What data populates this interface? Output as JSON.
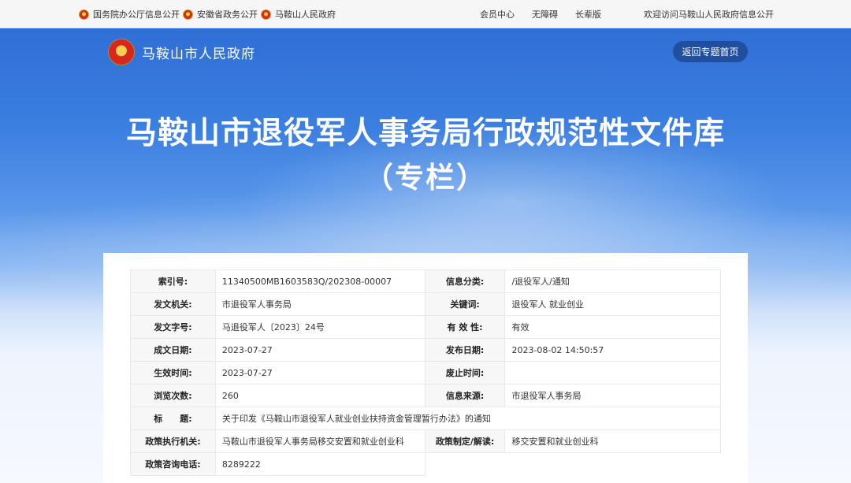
{
  "topbar": {
    "links": [
      "国务院办公厅信息公开",
      "安徽省政务公开",
      "马鞍山人民政府"
    ],
    "right_links": [
      "会员中心",
      "无障碍",
      "长辈版"
    ],
    "welcome": "欢迎访问马鞍山人民政府信息公开"
  },
  "header": {
    "site_name": "马鞍山市人民政府",
    "return_button": "返回专题首页",
    "title_line1": "马鞍山市退役军人事务局行政规范性文件库",
    "title_line2": "（专栏）"
  },
  "info": {
    "suoyin_label": "索引号:",
    "suoyin_value": "11340500MB1603583Q/202308-00007",
    "xinxifenlei_label": "信息分类:",
    "xinxifenlei_value": "/退役军人/通知",
    "fawenjiguan_label": "发文机关:",
    "fawenjiguan_value": "市退役军人事务局",
    "guanjianci_label": "关键词:",
    "guanjianci_value": "退役军人 就业创业",
    "fawenzihao_label": "发文字号:",
    "fawenzihao_value": "马退役军人〔2023〕24号",
    "youxiaoxing_label": "有 效 性:",
    "youxiaoxing_value": "有效",
    "chengwenriqi_label": "成文日期:",
    "chengwenriqi_value": "2023-07-27",
    "fabuRiqi_label": "发布日期:",
    "fabuRiqi_value": "2023-08-02 14:50:57",
    "shengxiao_label": "生效时间:",
    "shengxiao_value": "2023-07-27",
    "feizhi_label": "废止时间:",
    "feizhi_value": "",
    "liulan_label": "浏览次数:",
    "liulan_value": "260",
    "laiyuan_label": "信息来源:",
    "laiyuan_value": "市退役军人事务局",
    "biaoti_label": "标　　题:",
    "biaoti_value": "关于印发《马鞍山市退役军人就业创业扶持资金管理暂行办法》的通知",
    "zhixing_label": "政策执行机关:",
    "zhixing_value": "马鞍山市退役军人事务局移交安置和就业创业科",
    "zhiding_label": "政策制定/解读:",
    "zhiding_value": "移交安置和就业创业科",
    "dianhua_label": "政策咨询电话:",
    "dianhua_value": "8289222"
  }
}
